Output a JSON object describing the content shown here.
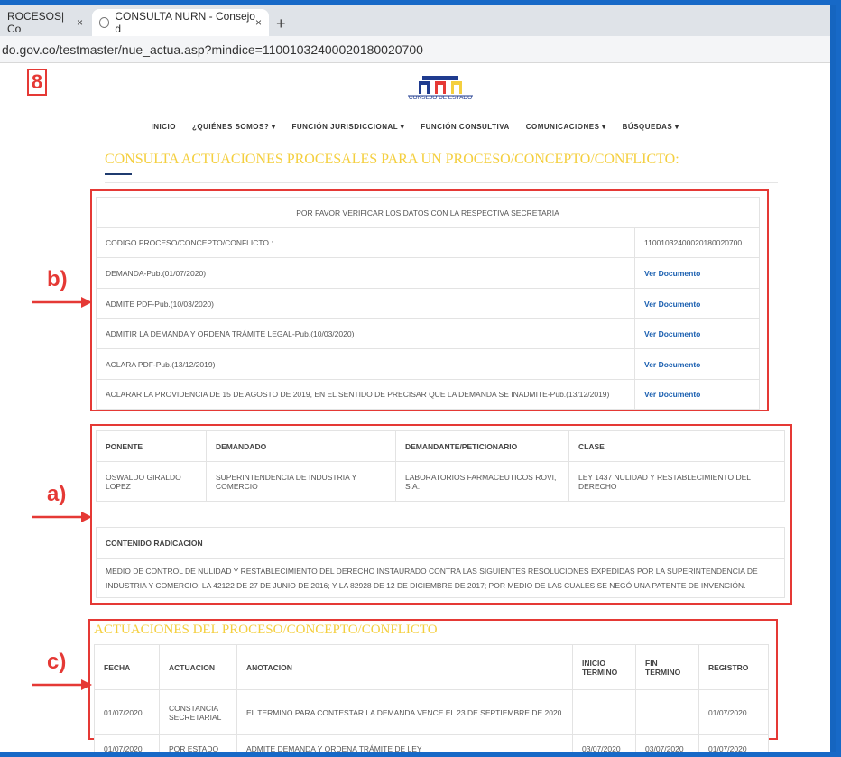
{
  "browser": {
    "tabs": [
      {
        "label": "ROCESOS| Co",
        "active": false
      },
      {
        "label": "CONSULTA NURN - Consejo d",
        "active": true
      }
    ],
    "close_glyph": "×",
    "new_tab_glyph": "+",
    "url": "do.gov.co/testmaster/nue_actua.asp?mindice=11001032400020180020700"
  },
  "annotation_number": "8",
  "logo_text": "CONSEJO DE ESTADO",
  "nav": [
    "INICIO",
    "¿QUIÉNES SOMOS? ▾",
    "FUNCIÓN JURISDICCIONAL ▾",
    "FUNCIÓN CONSULTIVA",
    "COMUNICACIONES ▾",
    "BÚSQUEDAS ▾"
  ],
  "heading": "CONSULTA ACTUACIONES PROCESALES PARA UN PROCESO/CONCEPTO/CONFLICTO:",
  "labels": {
    "a": "a)",
    "b": "b)",
    "c": "c)"
  },
  "docs": {
    "notice": "POR FAVOR VERIFICAR LOS DATOS CON LA RESPECTIVA SECRETARIA",
    "code_label": "CODIGO PROCESO/CONCEPTO/CONFLICTO :",
    "code_value": "11001032400020180020700",
    "rows": [
      {
        "name": "DEMANDA-Pub.(01/07/2020)",
        "link": "Ver Documento"
      },
      {
        "name": "ADMITE PDF-Pub.(10/03/2020)",
        "link": "Ver Documento"
      },
      {
        "name": "ADMITIR LA DEMANDA Y ORDENA TRÁMITE LEGAL-Pub.(10/03/2020)",
        "link": "Ver Documento"
      },
      {
        "name": "ACLARA PDF-Pub.(13/12/2019)",
        "link": "Ver Documento"
      },
      {
        "name": "ACLARAR LA PROVIDENCIA DE 15 DE AGOSTO DE 2019, EN EL SENTIDO DE PRECISAR QUE LA DEMANDA SE INADMITE-Pub.(13/12/2019)",
        "link": "Ver Documento"
      }
    ]
  },
  "parties": {
    "headers": [
      "PONENTE",
      "DEMANDADO",
      "DEMANDANTE/PETICIONARIO",
      "CLASE"
    ],
    "values": [
      "OSWALDO GIRALDO LOPEZ",
      "SUPERINTENDENCIA DE INDUSTRIA Y COMERCIO",
      "LABORATORIOS FARMACEUTICOS ROVI, S.A.",
      "LEY 1437 NULIDAD Y RESTABLECIMIENTO DEL DERECHO"
    ],
    "contenido_label": "CONTENIDO RADICACION",
    "contenido_text": "MEDIO DE CONTROL DE NULIDAD Y RESTABLECIMIENTO DEL DERECHO INSTAURADO CONTRA LAS SIGUIENTES RESOLUCIONES EXPEDIDAS POR LA SUPERINTENDENCIA DE INDUSTRIA Y COMERCIO: LA 42122 DE 27 DE JUNIO DE 2016; Y LA 82928 DE 12 DE DICIEMBRE DE 2017; POR MEDIO DE LAS CUALES SE NEGÓ UNA PATENTE DE INVENCIÓN."
  },
  "actuaciones": {
    "title": "ACTUACIONES DEL PROCESO/CONCEPTO/CONFLICTO",
    "headers": [
      "FECHA",
      "ACTUACION",
      "ANOTACION",
      "INICIO TERMINO",
      "FIN TERMINO",
      "REGISTRO"
    ],
    "rows": [
      [
        "01/07/2020",
        "CONSTANCIA SECRETARIAL",
        "EL TERMINO PARA CONTESTAR LA DEMANDA VENCE EL 23 DE SEPTIEMBRE DE 2020",
        "",
        "",
        "01/07/2020"
      ],
      [
        "01/07/2020",
        "POR ESTADO",
        "ADMITE DEMANDA Y ORDENA TRÁMITE DE LEY",
        "03/07/2020",
        "03/07/2020",
        "01/07/2020"
      ]
    ]
  }
}
